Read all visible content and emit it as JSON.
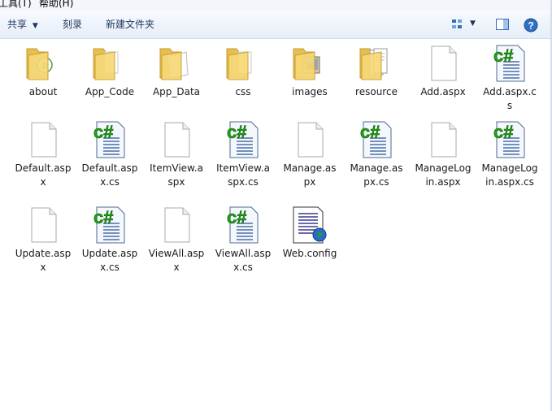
{
  "menubar": {
    "items": [
      "工具(T)",
      "帮助(H)"
    ]
  },
  "toolbar": {
    "share": "共享",
    "burn": "刻录",
    "new_folder": "新建文件夹"
  },
  "files": [
    {
      "name": "about",
      "type": "folder-web"
    },
    {
      "name": "App_Code",
      "type": "folder"
    },
    {
      "name": "App_Data",
      "type": "folder-open"
    },
    {
      "name": "css",
      "type": "folder"
    },
    {
      "name": "images",
      "type": "folder-images"
    },
    {
      "name": "resource",
      "type": "folder-docs"
    },
    {
      "name": "Add.aspx",
      "type": "blank"
    },
    {
      "name": "Add.aspx.cs",
      "type": "cs"
    },
    {
      "name": "Default.aspx",
      "type": "blank"
    },
    {
      "name": "Default.aspx.cs",
      "type": "cs"
    },
    {
      "name": "ItemView.aspx",
      "type": "blank"
    },
    {
      "name": "ItemView.aspx.cs",
      "type": "cs"
    },
    {
      "name": "Manage.aspx",
      "type": "blank"
    },
    {
      "name": "Manage.aspx.cs",
      "type": "cs"
    },
    {
      "name": "ManageLogin.aspx",
      "type": "blank"
    },
    {
      "name": "ManageLogin.aspx.cs",
      "type": "cs"
    },
    {
      "name": "Update.aspx",
      "type": "blank"
    },
    {
      "name": "Update.aspx.cs",
      "type": "cs"
    },
    {
      "name": "ViewAll.aspx",
      "type": "blank"
    },
    {
      "name": "ViewAll.aspx.cs",
      "type": "cs"
    },
    {
      "name": "Web.config",
      "type": "config"
    }
  ]
}
